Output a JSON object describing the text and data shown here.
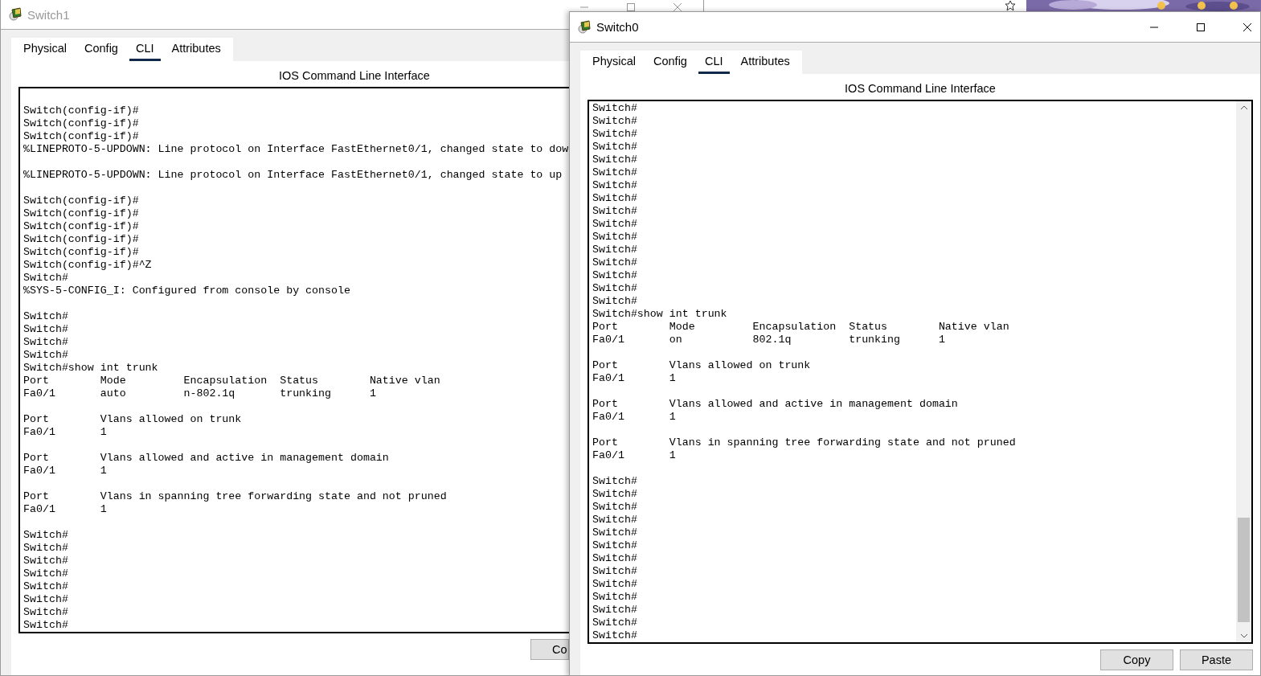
{
  "windows": [
    {
      "title": "Switch1",
      "active": false,
      "tabs": [
        {
          "label": "Physical",
          "selected": false
        },
        {
          "label": "Config",
          "selected": false
        },
        {
          "label": "CLI",
          "selected": true
        },
        {
          "label": "Attributes",
          "selected": false
        }
      ],
      "panel_title": "IOS Command Line Interface",
      "terminal_lines": [
        {
          "kind": "text",
          "text": "Switch(config-if)#"
        },
        {
          "kind": "text",
          "text": "Switch(config-if)#"
        },
        {
          "kind": "text",
          "text": "Switch(config-if)#"
        },
        {
          "kind": "text",
          "text": "%LINEPROTO-5-UPDOWN: Line protocol on Interface FastEthernet0/1, changed state to dow"
        },
        {
          "kind": "blank"
        },
        {
          "kind": "text",
          "text": "%LINEPROTO-5-UPDOWN: Line protocol on Interface FastEthernet0/1, changed state to up"
        },
        {
          "kind": "blank"
        },
        {
          "kind": "text",
          "text": "Switch(config-if)#"
        },
        {
          "kind": "text",
          "text": "Switch(config-if)#"
        },
        {
          "kind": "text",
          "text": "Switch(config-if)#"
        },
        {
          "kind": "text",
          "text": "Switch(config-if)#"
        },
        {
          "kind": "text",
          "text": "Switch(config-if)#"
        },
        {
          "kind": "text",
          "text": "Switch(config-if)#^Z"
        },
        {
          "kind": "text",
          "text": "Switch#"
        },
        {
          "kind": "text",
          "text": "%SYS-5-CONFIG_I: Configured from console by console"
        },
        {
          "kind": "blank"
        },
        {
          "kind": "text",
          "text": "Switch#"
        },
        {
          "kind": "text",
          "text": "Switch#"
        },
        {
          "kind": "text",
          "text": "Switch#"
        },
        {
          "kind": "text",
          "text": "Switch#"
        },
        {
          "kind": "text",
          "text": "Switch#show int trunk"
        },
        {
          "kind": "text",
          "text": "Port        Mode         Encapsulation  Status        Native vlan"
        },
        {
          "kind": "text",
          "text": "Fa0/1       auto         n-802.1q       trunking      1"
        },
        {
          "kind": "blank"
        },
        {
          "kind": "text",
          "text": "Port        Vlans allowed on trunk"
        },
        {
          "kind": "text",
          "text": "Fa0/1       1"
        },
        {
          "kind": "blank"
        },
        {
          "kind": "text",
          "text": "Port        Vlans allowed and active in management domain"
        },
        {
          "kind": "text",
          "text": "Fa0/1       1"
        },
        {
          "kind": "blank"
        },
        {
          "kind": "text",
          "text": "Port        Vlans in spanning tree forwarding state and not pruned"
        },
        {
          "kind": "text",
          "text": "Fa0/1       1"
        },
        {
          "kind": "blank"
        },
        {
          "kind": "text",
          "text": "Switch#"
        },
        {
          "kind": "text",
          "text": "Switch#"
        },
        {
          "kind": "text",
          "text": "Switch#"
        },
        {
          "kind": "text",
          "text": "Switch#"
        },
        {
          "kind": "text",
          "text": "Switch#"
        },
        {
          "kind": "text",
          "text": "Switch#"
        },
        {
          "kind": "text",
          "text": "Switch#"
        },
        {
          "kind": "text",
          "text": "Switch#"
        }
      ],
      "buttons": [
        "Co"
      ]
    },
    {
      "title": "Switch0",
      "active": true,
      "tabs": [
        {
          "label": "Physical",
          "selected": false
        },
        {
          "label": "Config",
          "selected": false
        },
        {
          "label": "CLI",
          "selected": true
        },
        {
          "label": "Attributes",
          "selected": false
        }
      ],
      "panel_title": "IOS Command Line Interface",
      "terminal_lines": [
        {
          "kind": "text",
          "text": "Switch#"
        },
        {
          "kind": "text",
          "text": "Switch#"
        },
        {
          "kind": "text",
          "text": "Switch#"
        },
        {
          "kind": "text",
          "text": "Switch#"
        },
        {
          "kind": "text",
          "text": "Switch#"
        },
        {
          "kind": "text",
          "text": "Switch#"
        },
        {
          "kind": "text",
          "text": "Switch#"
        },
        {
          "kind": "text",
          "text": "Switch#"
        },
        {
          "kind": "text",
          "text": "Switch#"
        },
        {
          "kind": "text",
          "text": "Switch#"
        },
        {
          "kind": "text",
          "text": "Switch#"
        },
        {
          "kind": "text",
          "text": "Switch#"
        },
        {
          "kind": "text",
          "text": "Switch#"
        },
        {
          "kind": "text",
          "text": "Switch#"
        },
        {
          "kind": "text",
          "text": "Switch#"
        },
        {
          "kind": "text",
          "text": "Switch#"
        },
        {
          "kind": "text",
          "text": "Switch#show int trunk"
        },
        {
          "kind": "text",
          "text": "Port        Mode         Encapsulation  Status        Native vlan"
        },
        {
          "kind": "text",
          "text": "Fa0/1       on           802.1q         trunking      1"
        },
        {
          "kind": "blank"
        },
        {
          "kind": "text",
          "text": "Port        Vlans allowed on trunk"
        },
        {
          "kind": "text",
          "text": "Fa0/1       1"
        },
        {
          "kind": "blank"
        },
        {
          "kind": "text",
          "text": "Port        Vlans allowed and active in management domain"
        },
        {
          "kind": "text",
          "text": "Fa0/1       1"
        },
        {
          "kind": "blank"
        },
        {
          "kind": "text",
          "text": "Port        Vlans in spanning tree forwarding state and not pruned"
        },
        {
          "kind": "text",
          "text": "Fa0/1       1"
        },
        {
          "kind": "blank"
        },
        {
          "kind": "text",
          "text": "Switch#"
        },
        {
          "kind": "text",
          "text": "Switch#"
        },
        {
          "kind": "text",
          "text": "Switch#"
        },
        {
          "kind": "text",
          "text": "Switch#"
        },
        {
          "kind": "text",
          "text": "Switch#"
        },
        {
          "kind": "text",
          "text": "Switch#"
        },
        {
          "kind": "text",
          "text": "Switch#"
        },
        {
          "kind": "text",
          "text": "Switch#"
        },
        {
          "kind": "text",
          "text": "Switch#"
        },
        {
          "kind": "text",
          "text": "Switch#"
        },
        {
          "kind": "text",
          "text": "Switch#"
        },
        {
          "kind": "text",
          "text": "Switch#"
        },
        {
          "kind": "text",
          "text": "Switch#"
        }
      ],
      "buttons": [
        "Copy",
        "Paste"
      ]
    }
  ]
}
